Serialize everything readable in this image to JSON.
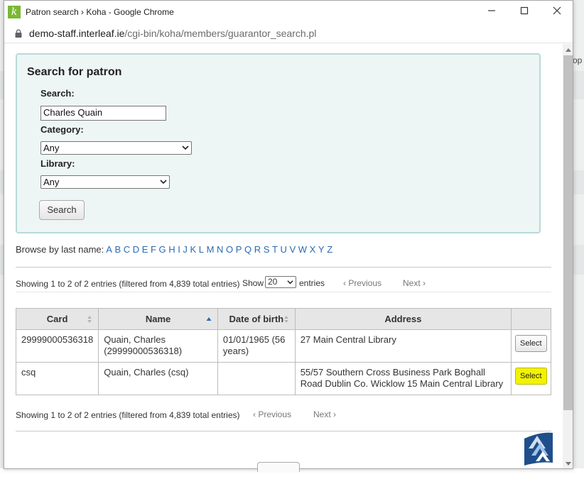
{
  "window": {
    "title": "Patron search › Koha - Google Chrome",
    "url_domain": "demo-staff.interleaf.ie",
    "url_path": "/cgi-bin/koha/members/guarantor_search.pl"
  },
  "background": {
    "right_fragment": "op"
  },
  "search": {
    "heading": "Search for patron",
    "search_label": "Search:",
    "search_value": "Charles Quain",
    "category_label": "Category:",
    "category_value": "Any",
    "library_label": "Library:",
    "library_value": "Any",
    "button_label": "Search"
  },
  "browse": {
    "label": "Browse by last name:",
    "letters": [
      "A",
      "B",
      "C",
      "D",
      "E",
      "F",
      "G",
      "H",
      "I",
      "J",
      "K",
      "L",
      "M",
      "N",
      "O",
      "P",
      "Q",
      "R",
      "S",
      "T",
      "U",
      "V",
      "W",
      "X",
      "Y",
      "Z"
    ]
  },
  "results": {
    "info_top": "Showing 1 to 2 of 2 entries (filtered from 4,839 total entries)",
    "show_label": "Show",
    "page_length": "20",
    "entries_label": "entries",
    "previous": "Previous",
    "next": "Next",
    "info_bottom": "Showing 1 to 2 of 2 entries (filtered from 4,839 total entries)",
    "columns": [
      "Card",
      "Name",
      "Date of birth",
      "Address",
      ""
    ],
    "rows": [
      {
        "card": "29999000536318",
        "name": "Quain, Charles (29999000536318)",
        "dob": "01/01/1965 (56 years)",
        "address": "27 Main Central Library",
        "action": "Select"
      },
      {
        "card": "csq",
        "name": "Quain, Charles (csq)",
        "dob": "",
        "address": "55/57 Southern Cross Business Park Boghall Road Dublin Co. Wicklow 15 Main Central Library",
        "action": "Select"
      }
    ]
  },
  "colors": {
    "link": "#2a6ab1",
    "panel_bg": "#eef5f5",
    "panel_border": "#b7dbd8",
    "highlight": "#f2f200",
    "koha_green": "#7ab932"
  }
}
